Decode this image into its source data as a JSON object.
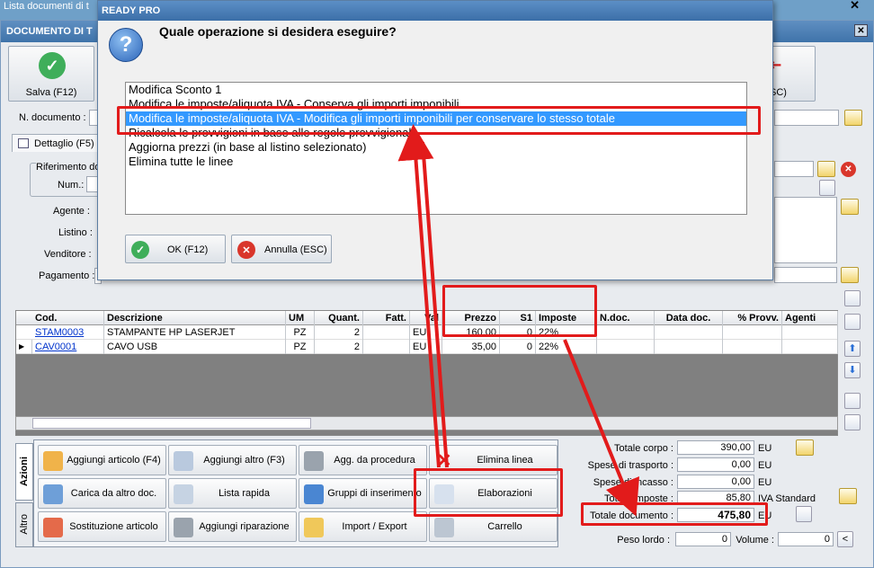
{
  "background_window": {
    "title": "Lista documenti di t"
  },
  "main_window": {
    "title": "DOCUMENTO DI T"
  },
  "toolbar": {
    "save_label": "Salva (F12)",
    "cancel_label": "(ESC)"
  },
  "header": {
    "doc_number_label": "N. documento :"
  },
  "tab_detail": "Dettaglio (F5)",
  "left_form": {
    "reference_group": "Riferimento do",
    "num_label": "Num.:",
    "agent_label": "Agente :",
    "pricelist_label": "Listino :",
    "seller_label": "Venditore :",
    "payment_label": "Pagamento :"
  },
  "grid": {
    "columns": [
      "Cod.",
      "Descrizione",
      "UM",
      "Quant.",
      "Fatt.",
      "Val",
      "Prezzo",
      "S1",
      "Imposte",
      "N.doc.",
      "Data doc.",
      "% Provv.",
      "Agenti"
    ],
    "rows": [
      {
        "code": "STAM0003",
        "desc": "STAMPANTE HP LASERJET",
        "um": "PZ",
        "qty": "2",
        "val": "EU",
        "price": "160,00",
        "s1": "0",
        "tax": "22%"
      },
      {
        "code": "CAV0001",
        "desc": "CAVO USB",
        "um": "PZ",
        "qty": "2",
        "val": "EU",
        "price": "35,00",
        "s1": "0",
        "tax": "22%"
      }
    ]
  },
  "actions": {
    "tab_actions": "Azioni",
    "tab_other": "Altro",
    "buttons": [
      [
        "Aggiungi articolo (F4)",
        "Aggiungi altro (F3)",
        "Agg. da procedura",
        "Elimina linea"
      ],
      [
        "Carica da altro doc.",
        "Lista rapida",
        "Gruppi di inserimento",
        "Elaborazioni"
      ],
      [
        "Sostituzione articolo",
        "Aggiungi riparazione",
        "Import / Export",
        "Carrello"
      ]
    ]
  },
  "totals": {
    "corpo_label": "Totale corpo :",
    "corpo": "390,00",
    "corpo_cur": "EU",
    "trasporto_label": "Spese di trasporto :",
    "trasporto": "0,00",
    "trasporto_cur": "EU",
    "incasso_label": "Spese di incasso :",
    "incasso": "0,00",
    "incasso_cur": "EU",
    "imposte_label": "Totale imposte :",
    "imposte": "85,80",
    "imposte_note": "IVA Standard",
    "documento_label": "Totale documento :",
    "documento": "475,80",
    "documento_cur": "EU",
    "peso_label": "Peso lordo :",
    "peso": "0",
    "volume_label": "Volume :",
    "volume": "0"
  },
  "dialog": {
    "title": "READY PRO",
    "question": "Quale operazione si desidera eseguire?",
    "options": [
      "Modifica Sconto 1",
      "Modifica le imposte/aliquota IVA - Conserva gli importi imponibili",
      "Modifica le imposte/aliquota IVA - Modifica gli importi imponibili per conservare lo stesso totale",
      "Ricalcola le provvigioni in base alle regole provvigionali",
      "Aggiorna prezzi (in base al listino selezionato)",
      "Elimina tutte le linee"
    ],
    "selected_index": 2,
    "ok_label": "OK (F12)",
    "cancel_label": "Annulla (ESC)"
  },
  "colors": {
    "accent": "#3399ff",
    "annotation": "#e21b1b",
    "ok_green": "#3fae5a",
    "cancel_red": "#d9362b"
  }
}
